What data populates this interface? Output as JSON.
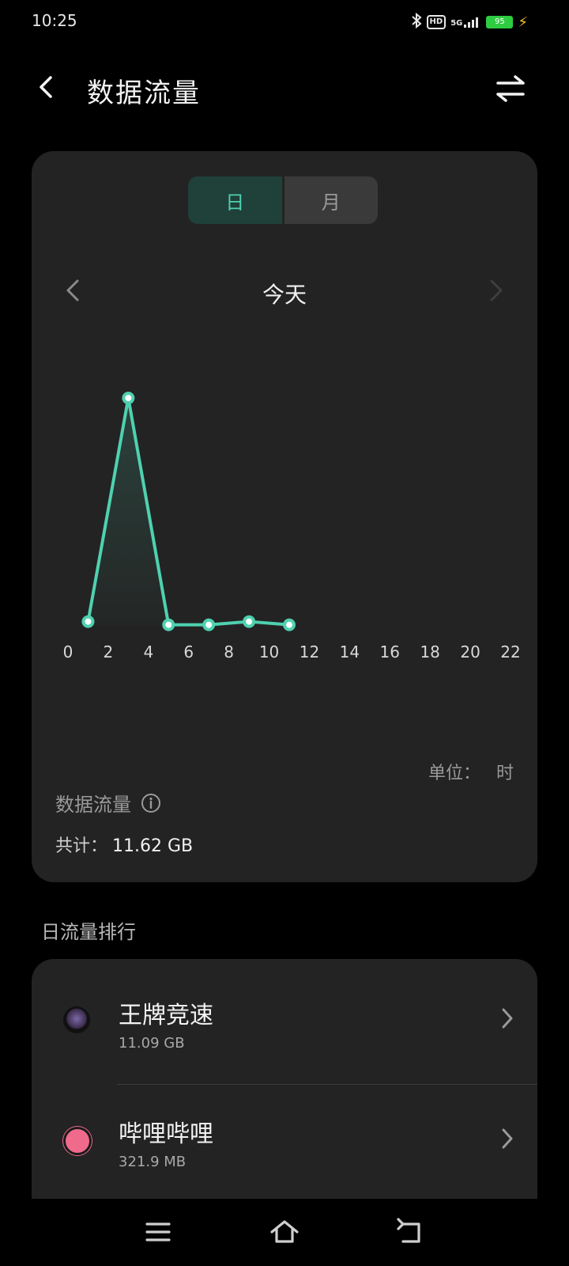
{
  "status_bar": {
    "time": "10:25",
    "network": "5G",
    "hd": "HD",
    "battery": "95"
  },
  "header": {
    "title": "数据流量",
    "back_icon": "chevron-left-icon",
    "switch_icon": "swap-arrows-icon"
  },
  "segmented": {
    "day_label": "日",
    "month_label": "月",
    "selected": "day"
  },
  "date_nav": {
    "label": "今天"
  },
  "chart_data": {
    "type": "line",
    "x": [
      1,
      3,
      5,
      7,
      9,
      11
    ],
    "values": [
      0.2,
      10.6,
      0.05,
      0.05,
      0.2,
      0.05
    ],
    "xticks": [
      "0",
      "2",
      "4",
      "6",
      "8",
      "10",
      "12",
      "14",
      "16",
      "18",
      "20",
      "22"
    ],
    "xlim": [
      0,
      22
    ],
    "color": "#4fd1b0"
  },
  "unit": {
    "label": "单位：",
    "value": "时"
  },
  "summary": {
    "title": "数据流量",
    "total_label": "共计：",
    "total_value": "11.62 GB"
  },
  "ranking": {
    "title": "日流量排行",
    "items": [
      {
        "name": "王牌竞速",
        "usage": "11.09 GB"
      },
      {
        "name": "哔哩哔哩",
        "usage": "321.9 MB"
      }
    ]
  },
  "colors": {
    "accent": "#4fd1b0",
    "card": "#232323",
    "background": "#000000"
  }
}
